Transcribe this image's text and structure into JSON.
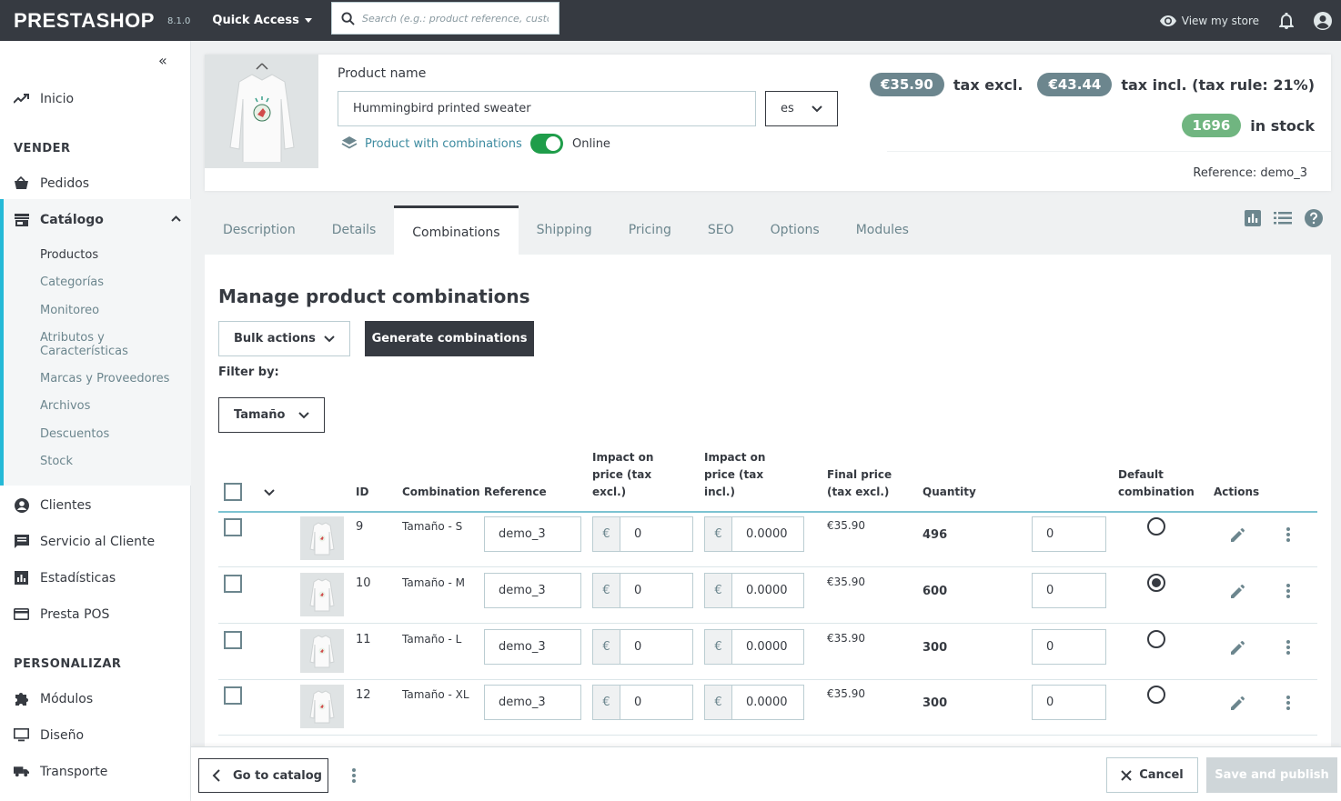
{
  "topbar": {
    "logo": "PRESTASHOP",
    "version": "8.1.0",
    "quick_access": "Quick Access",
    "search_placeholder": "Search (e.g.: product reference, custo",
    "view_store": "View my store"
  },
  "sidebar": {
    "home": "Inicio",
    "section_sell": "VENDER",
    "orders": "Pedidos",
    "catalog": "Catálogo",
    "catalog_items": [
      "Productos",
      "Categorías",
      "Monitoreo",
      "Atributos y Características",
      "Marcas y Proveedores",
      "Archivos",
      "Descuentos",
      "Stock"
    ],
    "customers": "Clientes",
    "customer_service": "Servicio al Cliente",
    "stats": "Estadísticas",
    "presta_pos": "Presta POS",
    "section_customize": "PERSONALIZAR",
    "modules": "Módulos",
    "design": "Diseño",
    "shipping": "Transporte"
  },
  "header": {
    "product_name_label": "Product name",
    "product_name": "Hummingbird printed sweater",
    "language": "es",
    "product_type": "Product with combinations",
    "status": "Online",
    "price_excl": "€35.90",
    "price_excl_label": "tax excl.",
    "price_incl": "€43.44",
    "price_incl_label": "tax incl. (tax rule: 21%)",
    "stock": "1696",
    "stock_label": "in stock",
    "reference": "Reference: demo_3"
  },
  "tabs": [
    "Description",
    "Details",
    "Combinations",
    "Shipping",
    "Pricing",
    "SEO",
    "Options",
    "Modules"
  ],
  "combinations": {
    "title": "Manage product combinations",
    "bulk_actions": "Bulk actions",
    "generate": "Generate combinations",
    "filter_by": "Filter by:",
    "filter_value": "Tamaño",
    "headers": {
      "id": "ID",
      "combination": "Combination",
      "reference": "Reference",
      "impact_excl": "Impact on price (tax excl.)",
      "impact_incl": "Impact on price (tax incl.)",
      "final_price": "Final price (tax excl.)",
      "quantity": "Quantity",
      "default": "Default combination",
      "actions": "Actions"
    },
    "currency": "€",
    "rows": [
      {
        "id": "9",
        "name": "Tamaño - S",
        "reference": "demo_3",
        "impact_excl": "0",
        "impact_incl": "0.0000",
        "final_price": "€35.90",
        "quantity": "496",
        "delta": "0"
      },
      {
        "id": "10",
        "name": "Tamaño - M",
        "reference": "demo_3",
        "impact_excl": "0",
        "impact_incl": "0.0000",
        "final_price": "€35.90",
        "quantity": "600",
        "delta": "0"
      },
      {
        "id": "11",
        "name": "Tamaño - L",
        "reference": "demo_3",
        "impact_excl": "0",
        "impact_incl": "0.0000",
        "final_price": "€35.90",
        "quantity": "300",
        "delta": "0"
      },
      {
        "id": "12",
        "name": "Tamaño - XL",
        "reference": "demo_3",
        "impact_excl": "0",
        "impact_incl": "0.0000",
        "final_price": "€35.90",
        "quantity": "300",
        "delta": "0"
      }
    ],
    "default_row": 1
  },
  "footer": {
    "go_to_catalog": "Go to catalog",
    "cancel": "Cancel",
    "save": "Save and publish"
  },
  "colors": {
    "topbar": "#363a41",
    "accent": "#25b9d7",
    "toggle_on": "#1f9d4a",
    "stock_badge": "#70b580",
    "price_badge": "#6c868e"
  }
}
